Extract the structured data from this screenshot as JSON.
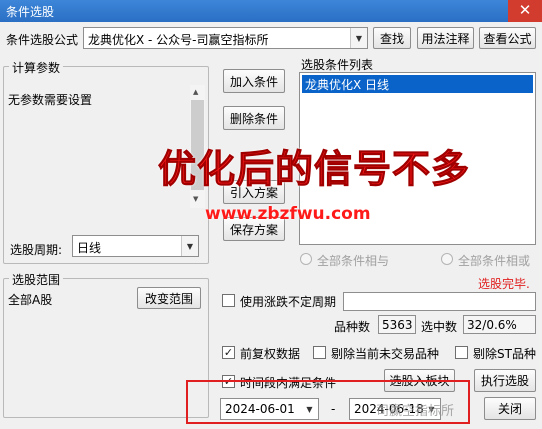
{
  "window": {
    "title": "条件选股",
    "close_glyph": "✕"
  },
  "formula": {
    "label": "条件选股公式",
    "value": "龙典优化X  -  公众号-司赢空指标所",
    "find_button": "查找",
    "usage_button": "用法注释",
    "view_button": "查看公式"
  },
  "params": {
    "legend": "计算参数",
    "content": "无参数需要设置"
  },
  "period": {
    "label": "选股周期:",
    "value": "日线"
  },
  "actions": {
    "add": "加入条件",
    "delete": "删除条件",
    "import": "引入方案",
    "save": "保存方案"
  },
  "conditions": {
    "label": "选股条件列表",
    "items": [
      "龙典优化X  日线"
    ]
  },
  "logic": {
    "and_label": "全部条件相与",
    "or_label": "全部条件相或",
    "status": "选股完毕."
  },
  "scope": {
    "legend": "选股范围",
    "value": "全部A股",
    "change_button": "改变范围"
  },
  "options": {
    "uncertain_period": "使用涨跌不定周期",
    "count_label": "品种数",
    "count_value": "5363",
    "selected_label": "选中数",
    "selected_value": "32/0.6%",
    "restore_rights": "前复权数据",
    "exclude_untraded": "剔除当前未交易品种",
    "exclude_st": "剔除ST品种",
    "time_range": "时间段内满足条件",
    "check_mark": "✓"
  },
  "bottom": {
    "to_block": "选股入板块",
    "execute": "执行选股",
    "close": "关闭",
    "date_start": "2024-06-01",
    "date_sep": "-",
    "date_end": "2024-06-18"
  },
  "overlay": {
    "headline": "优化后的信号不多",
    "website": "www.zbzfwu.com",
    "watermark": "司赢空指标所"
  },
  "colors": {
    "titlebar": "#2a6fc4",
    "selection": "#0a63c8",
    "overlay_red": "#ff1a1a",
    "status_red": "#e02020"
  }
}
